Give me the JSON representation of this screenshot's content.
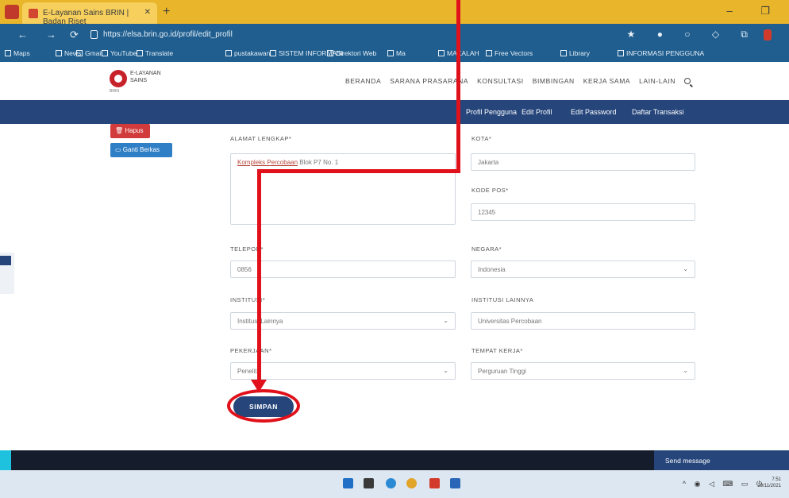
{
  "browser": {
    "tab_title": "E-Layanan Sains BRIN | Badan Riset",
    "url": "https://elsa.brin.go.id/profil/edit_profil",
    "bookmarks": [
      "Maps",
      "News",
      "Gmail",
      "YouTube",
      "Translate",
      "pustakawan",
      "SISTEM INFORMASI",
      "Direktori Web",
      "Ma",
      "MAKALAH",
      "Free Vectors",
      "Library",
      "INFORMASI PENGGUNA"
    ]
  },
  "site": {
    "logo_title": "E-LAYANAN",
    "logo_subtitle": "SAINS",
    "logo_org": "BRIN",
    "nav": [
      "BERANDA",
      "SARANA PRASARANA",
      "KONSULTASI",
      "BIMBINGAN",
      "KERJA SAMA",
      "LAIN-LAIN"
    ]
  },
  "subnav": [
    "Profil Pengguna",
    "Edit Profil",
    "Edit Password",
    "Daftar Transaksi"
  ],
  "side": {
    "delete_label": "Hapus",
    "change_photo_label": "Ganti Berkas"
  },
  "form": {
    "alamat_label": "ALAMAT LENGKAP*",
    "alamat_highlight": "Kompleks Percobaan",
    "alamat_value": " Blok P7 No. 1",
    "kota_label": "KOTA*",
    "kota_value": "Jakarta",
    "kodepos_label": "KODE POS*",
    "kodepos_value": "12345",
    "telepon_label": "TELEPON*",
    "telepon_value": "0856",
    "negara_label": "NEGARA*",
    "negara_value": "Indonesia",
    "institusi_label": "INSTITUSI*",
    "institusi_value": "Institusi Lainnya",
    "institusi_lain_label": "INSTITUSI LAINNYA",
    "institusi_lain_value": "Universitas Percobaan",
    "pekerjaan_label": "PEKERJAAN*",
    "pekerjaan_value": "Peneliti",
    "tempat_kerja_label": "TEMPAT KERJA*",
    "tempat_kerja_value": "Perguruan Tinggi",
    "save_label": "SIMPAN"
  },
  "footer": {
    "send_message": "Send message"
  },
  "taskbar": {
    "time": "7:51",
    "date": "29/11/2021"
  },
  "colors": {
    "primary": "#25457b",
    "annotation": "#e0111b",
    "browser_tab": "#e9b52a",
    "browser_bar": "#1f5e8f"
  }
}
